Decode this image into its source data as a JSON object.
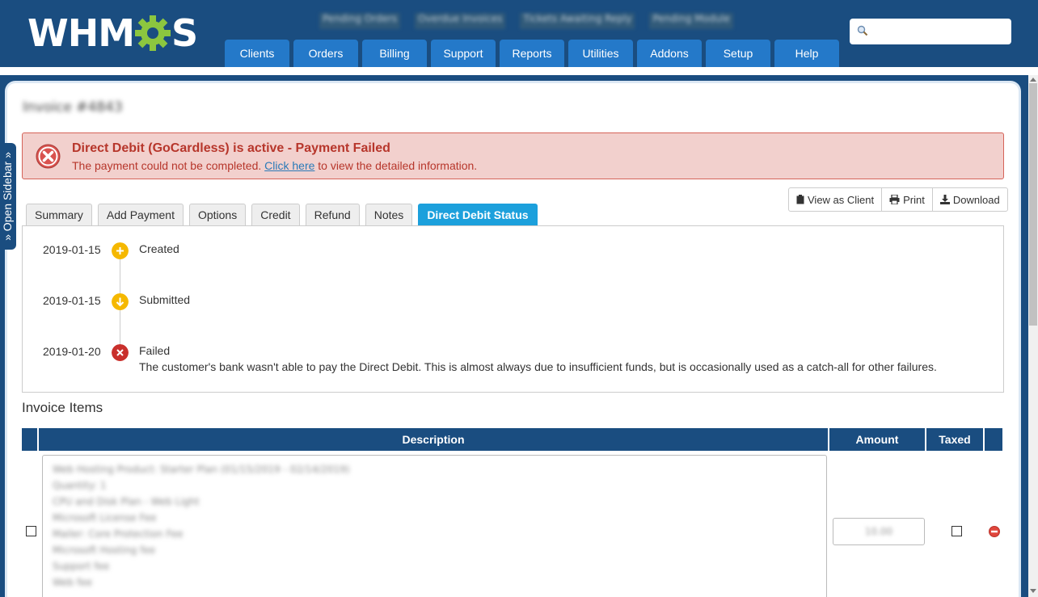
{
  "header": {
    "logo_text_1": "WHM",
    "logo_text_2": "S",
    "search_placeholder": "",
    "nav": [
      "Clients",
      "Orders",
      "Billing",
      "Support",
      "Reports",
      "Utilities",
      "Addons",
      "Setup",
      "Help"
    ],
    "top_info": [
      "Pending Orders",
      "Overdue Invoices",
      "Tickets Awaiting Reply",
      "Pending Module"
    ]
  },
  "sidebar": {
    "open_label": "» Open Sidebar »"
  },
  "page": {
    "title": "Invoice #4843"
  },
  "alert": {
    "title": "Direct Debit (GoCardless) is active - Payment Failed",
    "message_before": "The payment could not be completed.",
    "link": "Click here",
    "message_after": "to view the detailed information."
  },
  "actions": {
    "view_as_client": "View as Client",
    "print": "Print",
    "download": "Download"
  },
  "tabs": [
    "Summary",
    "Add Payment",
    "Options",
    "Credit",
    "Refund",
    "Notes",
    "Direct Debit Status"
  ],
  "active_tab": "Direct Debit Status",
  "timeline": [
    {
      "date": "2019-01-15",
      "label": "Created",
      "status": "created",
      "color": "#f5b800",
      "description": ""
    },
    {
      "date": "2019-01-15",
      "label": "Submitted",
      "status": "submitted",
      "color": "#f5b800",
      "description": ""
    },
    {
      "date": "2019-01-20",
      "label": "Failed",
      "status": "failed",
      "color": "#c9302c",
      "description": "The customer's bank wasn't able to pay the Direct Debit. This is almost always due to insufficient funds, but is occasionally used as a catch-all for other failures."
    }
  ],
  "invoice_items": {
    "title": "Invoice Items",
    "columns": {
      "description": "Description",
      "amount": "Amount",
      "taxed": "Taxed"
    },
    "rows": [
      {
        "description_lines": [
          "Web Hosting Product: Starter Plan (01/15/2019 - 02/14/2019)",
          "Quantity: 1",
          "CPU and Disk Plan - Web Light",
          "Microsoft License Fee",
          "Mailer: Core Protection Fee",
          "Microsoft Hosting fee",
          "Support fee",
          "Web fee"
        ],
        "amount": "10.00"
      }
    ]
  },
  "colors": {
    "header": "#1a4d80",
    "nav_tab": "#2479c9",
    "active_tab": "#1ca0dc",
    "alert_bg": "#f2d0cd",
    "alert_text": "#b7362b"
  }
}
